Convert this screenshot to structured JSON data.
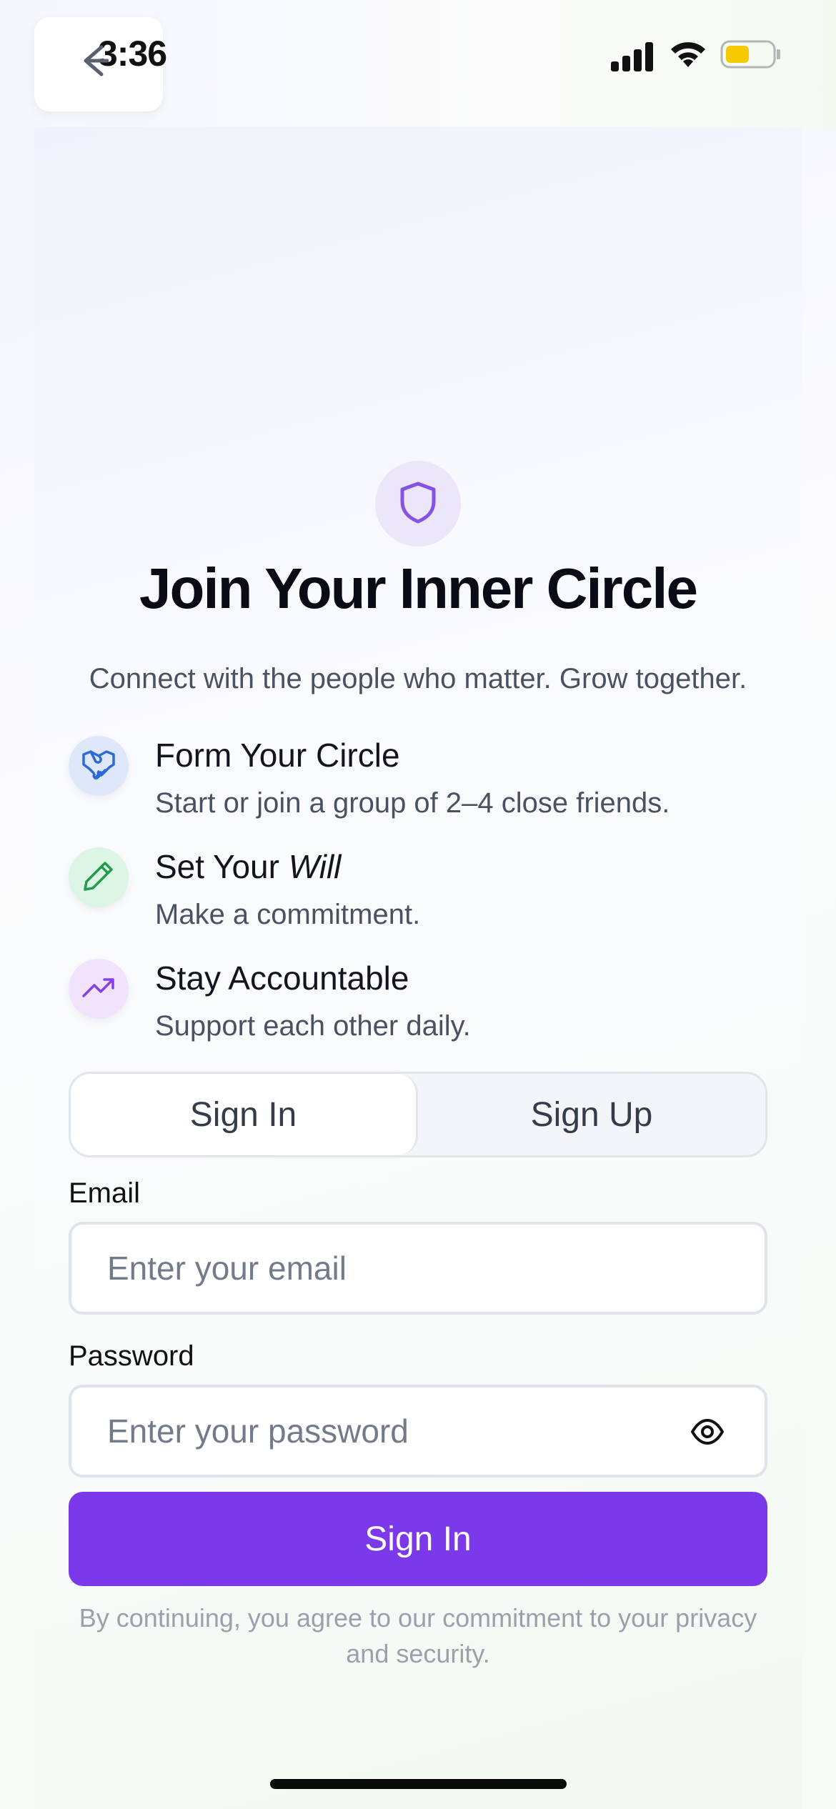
{
  "status_bar": {
    "time": "3:36",
    "icons": [
      "signal-icon",
      "wifi-icon",
      "battery-icon"
    ]
  },
  "header": {
    "back_icon": "back-arrow-icon"
  },
  "hero": {
    "icon": "shield-icon",
    "title": "Join Your Inner Circle",
    "subtitle": "Connect with the people who matter. Grow together."
  },
  "features": [
    {
      "icon": "handshake-icon",
      "title": "Form Your Circle",
      "description": "Start or join a group of 2–4 close friends."
    },
    {
      "icon": "pencil-icon",
      "title_prefix": "Set Your ",
      "title_emphasis": "Will",
      "description": "Make a commitment."
    },
    {
      "icon": "trending-up-icon",
      "title": "Stay Accountable",
      "description": "Support each other daily."
    }
  ],
  "auth_tabs": {
    "items": [
      "Sign In",
      "Sign Up"
    ],
    "selected": "Sign In"
  },
  "form": {
    "email_label": "Email",
    "email_placeholder": "Enter your email",
    "email_value": "",
    "password_label": "Password",
    "password_placeholder": "Enter your password",
    "password_value": "",
    "password_toggle_icon": "eye-icon",
    "submit_label": "Sign In"
  },
  "legal": {
    "text": "By continuing, you agree to our commitment to your privacy and security."
  },
  "colors": {
    "primary": "#7b39e9",
    "shield_badge_bg": "#ece6fb",
    "handshake_bg": "#dfe8fb",
    "pencil_bg": "#ddf5e4",
    "trend_bg": "#f1e3fb"
  }
}
